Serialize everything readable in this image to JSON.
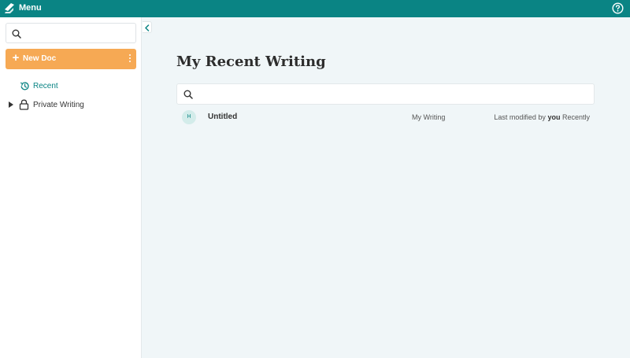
{
  "topbar": {
    "menu_label": "Menu",
    "logo_icon": "pen-logo-icon",
    "help_icon": "help-circle-icon",
    "bar_color": "#0a8484"
  },
  "sidebar": {
    "search": {
      "placeholder": "",
      "value": ""
    },
    "new_doc": {
      "label": "New Doc",
      "color": "#f6a954"
    },
    "items": [
      {
        "label": "Recent",
        "icon": "history-icon",
        "active": true
      },
      {
        "label": "Private Writing",
        "icon": "lock-icon",
        "expandable": true
      }
    ]
  },
  "main": {
    "title": "My Recent Writing",
    "search": {
      "placeholder": "",
      "value": ""
    },
    "documents": [
      {
        "avatar": "H",
        "title": "Untitled",
        "folder": "My Writing",
        "modified_prefix": "Last modified by",
        "modified_by": "you",
        "modified_when": "Recently"
      }
    ]
  }
}
